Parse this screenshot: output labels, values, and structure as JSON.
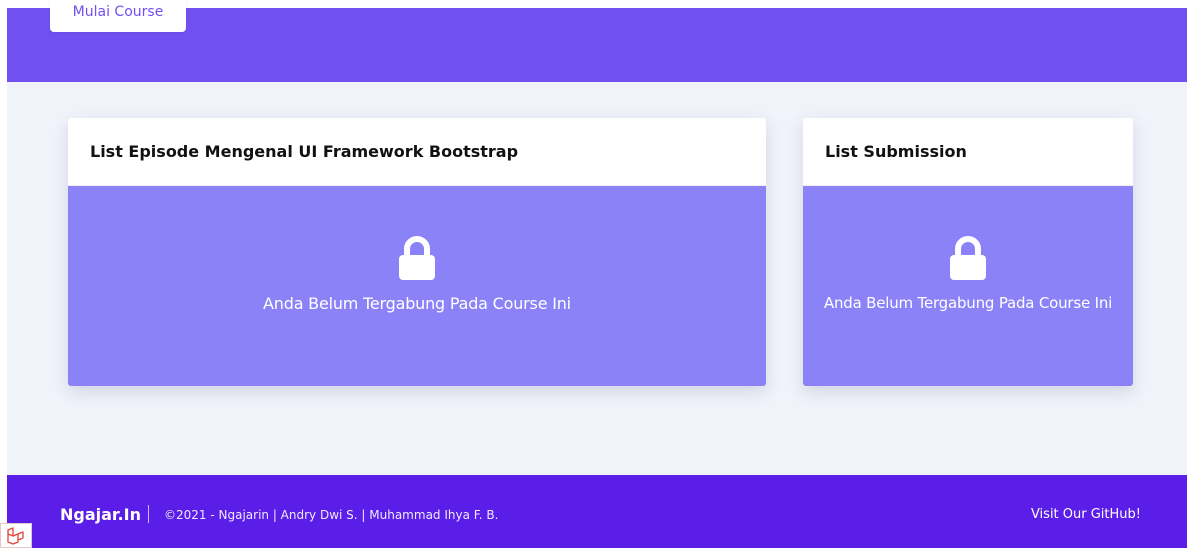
{
  "hero": {
    "start_button_label": "Mulai Course"
  },
  "episode_card": {
    "title": "List Episode Mengenal UI Framework Bootstrap",
    "locked_message": "Anda Belum Tergabung Pada Course Ini",
    "icon": "lock-icon"
  },
  "submission_card": {
    "title": "List Submission",
    "locked_message": "Anda Belum Tergabung Pada Course Ini",
    "icon": "lock-icon"
  },
  "footer": {
    "brand": "Ngajar.In",
    "copyright": "©2021 - Ngajarin | Andry Dwi S. | Muhammad Ihya F. B.",
    "github_link": "Visit Our GitHub!"
  },
  "colors": {
    "hero_bg": "#7150f2",
    "content_bg": "#f0f3fa",
    "card_body_bg": "#8a82f6",
    "footer_bg": "#5b1de8"
  }
}
